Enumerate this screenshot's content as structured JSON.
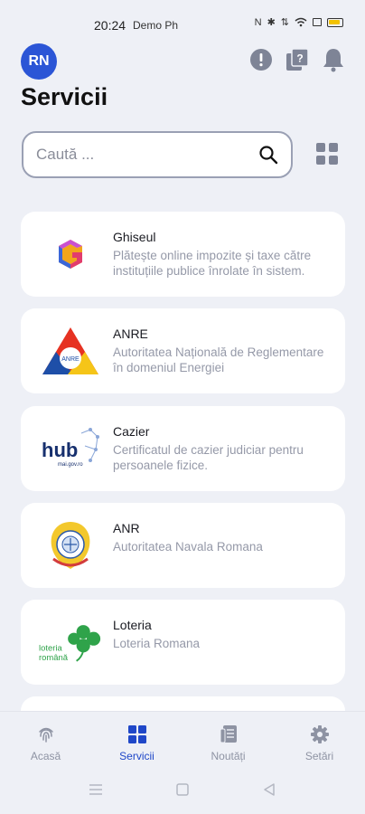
{
  "status_bar": {
    "time": "20:24",
    "carrier": "Demo Ph",
    "icons": [
      "nfc-icon",
      "bluetooth-icon",
      "data-icon",
      "wifi-icon",
      "screen-icon",
      "battery-icon"
    ]
  },
  "header": {
    "avatar_initials": "RN",
    "title": "Servicii",
    "icons": [
      "alert-icon",
      "help-icon",
      "bell-icon"
    ]
  },
  "search": {
    "placeholder": "Caută ..."
  },
  "services": [
    {
      "title": "Ghiseul",
      "description": "Plătește online impozite și taxe către instituțiile publice înrolate în sistem.",
      "logo": "ghiseul-logo"
    },
    {
      "title": "ANRE",
      "description": "Autoritatea Națională de Reglementare în domeniul Energiei",
      "logo": "anre-logo",
      "logo_text": "ANRE"
    },
    {
      "title": "Cazier",
      "description": "Certificatul de cazier judiciar pentru persoanele fizice.",
      "logo": "hub-logo",
      "logo_text": "hub",
      "logo_subtext": "mai.gov.ro"
    },
    {
      "title": "ANR",
      "description": "Autoritatea Navala Romana",
      "logo": "anr-emblem"
    },
    {
      "title": "Loteria",
      "description": "Loteria Romana",
      "logo": "loteria-logo",
      "logo_text": "loteria",
      "logo_subtext": "română"
    }
  ],
  "bottom_nav": [
    {
      "label": "Acasă",
      "icon": "fingerprint-icon",
      "active": false
    },
    {
      "label": "Servicii",
      "icon": "grid-icon",
      "active": true
    },
    {
      "label": "Noutăți",
      "icon": "news-icon",
      "active": false
    },
    {
      "label": "Setări",
      "icon": "gear-icon",
      "active": false
    }
  ],
  "colors": {
    "accent": "#2b55d6",
    "background": "#eef0f6",
    "icon_gray": "#7e8496"
  }
}
